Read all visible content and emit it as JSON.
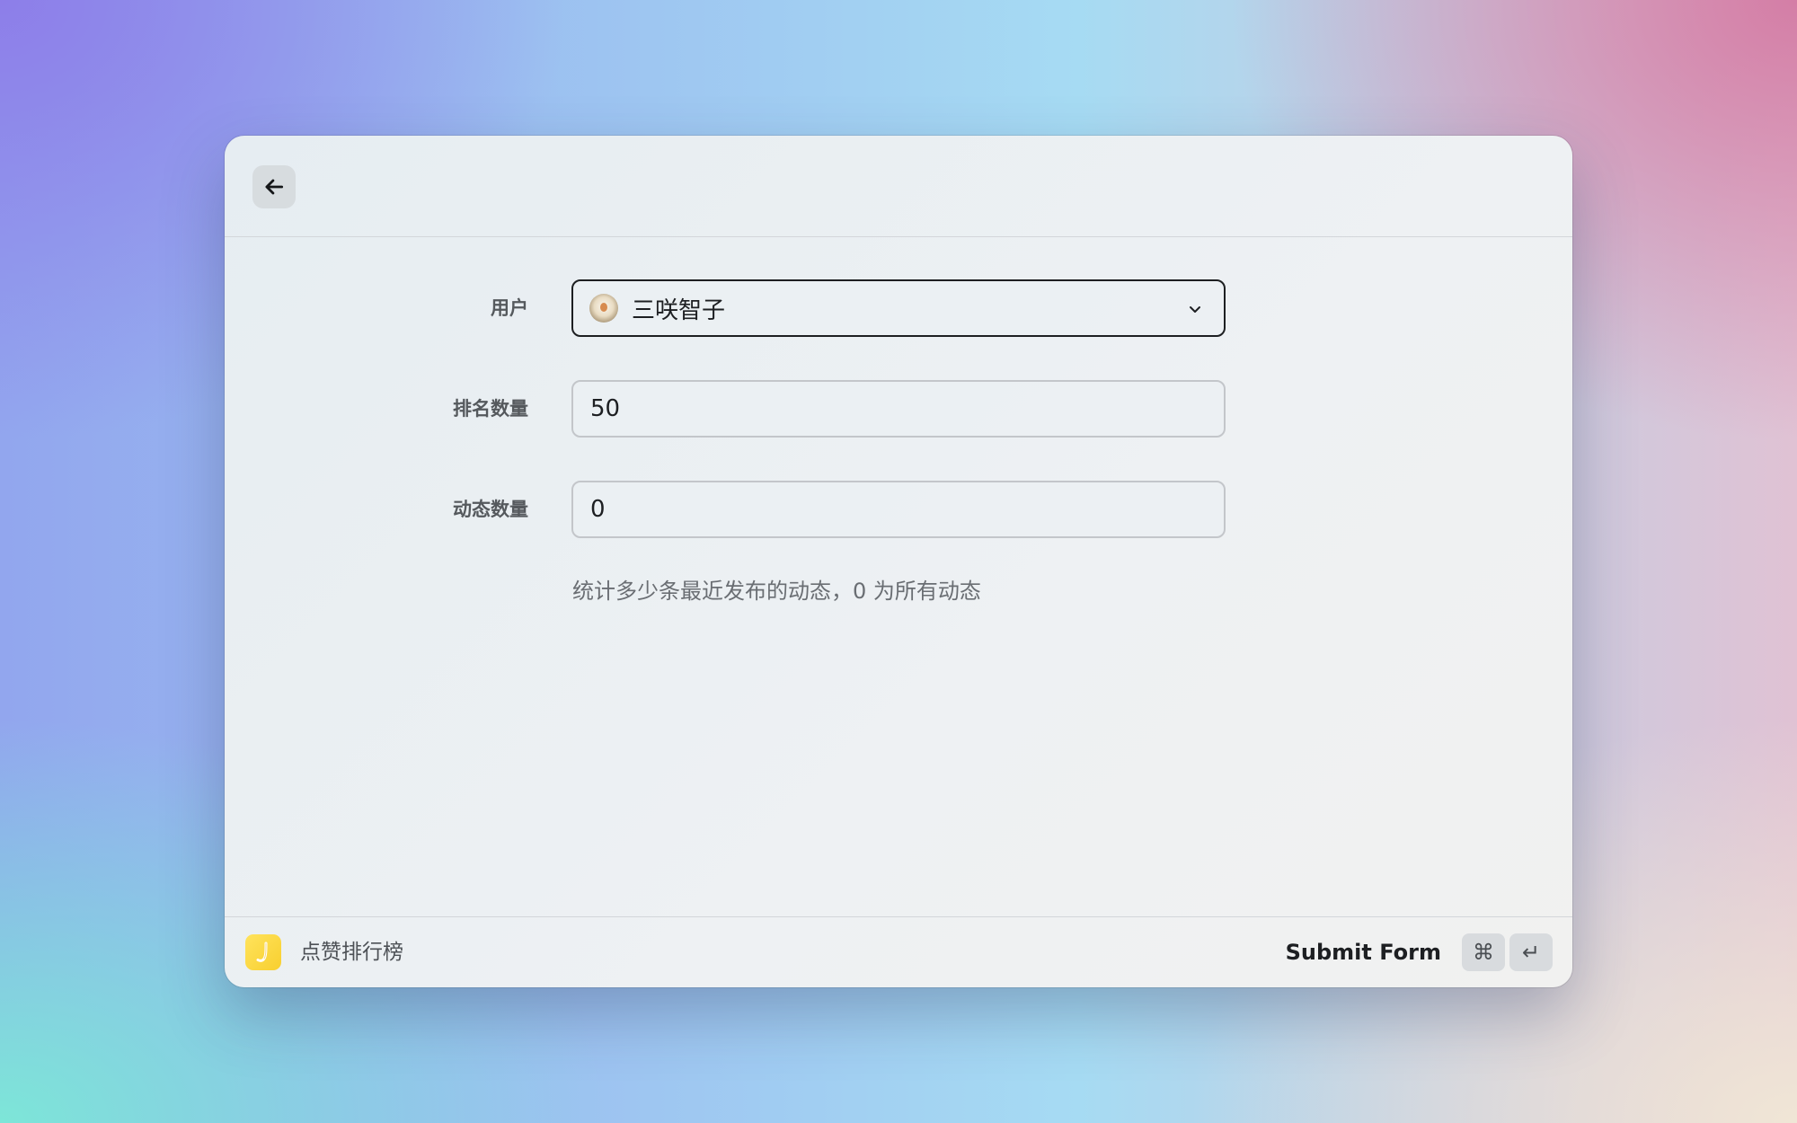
{
  "window": {
    "back_icon": "arrow-left-icon"
  },
  "form": {
    "user": {
      "label": "用户",
      "value": "三咲智子",
      "avatar_icon": "user-avatar"
    },
    "rank_count": {
      "label": "排名数量",
      "value": "50"
    },
    "post_count": {
      "label": "动态数量",
      "value": "0",
      "hint": "统计多少条最近发布的动态，0 为所有动态"
    }
  },
  "footer": {
    "app_name": "点赞排行榜",
    "app_icon_color": "#fbd93e",
    "submit_label": "Submit Form",
    "shortcut_keys": [
      "⌘",
      "↵"
    ]
  }
}
